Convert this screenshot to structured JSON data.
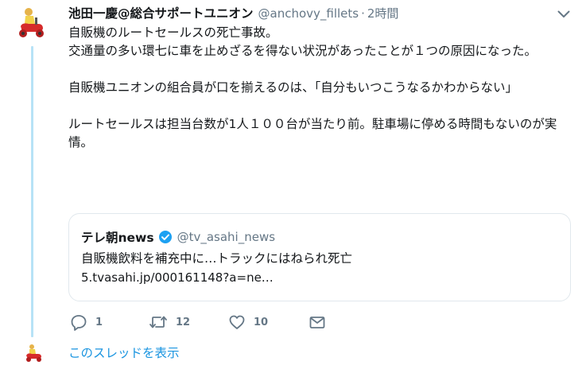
{
  "tweet": {
    "display_name": "池田一慶@総合サポートユニオン",
    "handle": "@anchovy_fillets",
    "separator": "·",
    "timestamp": "2時間",
    "paragraphs": [
      "自販機のルートセールスの死亡事故。\n交通量の多い環七に車を止めざるを得ない状況があったことが１つの原因になった。",
      "自販機ユニオンの組合員が口を揃えるのは、「自分もいつこうなるかわからない」",
      "ルートセールスは担当台数が1人１００台が当たり前。駐車場に停める時間もないのが実情。"
    ]
  },
  "quote": {
    "name": "テレ朝news",
    "handle": "@tv_asahi_news",
    "text": "自販機飲料を補充中に…トラックにはねられ死亡",
    "link": "5.tvasahi.jp/000161148?a=ne…"
  },
  "actions": {
    "reply_count": "1",
    "retweet_count": "12",
    "like_count": "10"
  },
  "thread_link": "このスレッドを表示",
  "icons": {
    "caret": "chevron-down-icon",
    "verified": "verified-badge-icon",
    "reply": "reply-icon",
    "retweet": "retweet-icon",
    "like": "heart-icon",
    "dm": "envelope-icon"
  },
  "colors": {
    "link": "#1b95e0",
    "muted": "#657786",
    "thread_line": "#b7e2f6",
    "verified": "#1da1f2"
  }
}
